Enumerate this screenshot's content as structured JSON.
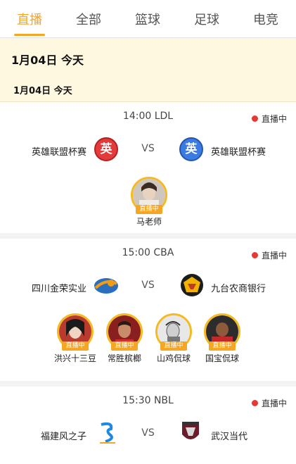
{
  "tabs": [
    {
      "label": "直播",
      "active": true
    },
    {
      "label": "全部",
      "active": false
    },
    {
      "label": "篮球",
      "active": false
    },
    {
      "label": "足球",
      "active": false
    },
    {
      "label": "电竞",
      "active": false
    }
  ],
  "accent_color": "#f5a623",
  "live_dot_color": "#e53935",
  "date_banner": {
    "main": "1月04日 今天",
    "sub": "1月04日 今天"
  },
  "matches": [
    {
      "time_league": "14:00 LDL",
      "status": "直播中",
      "home": {
        "name": "英雄联盟杯赛",
        "logo_text": "英"
      },
      "vs": "VS",
      "away": {
        "name": "英雄联盟杯赛",
        "logo_text": "英"
      },
      "anchors": [
        {
          "name": "马老师",
          "badge": "直播中"
        }
      ]
    },
    {
      "time_league": "15:00 CBA",
      "status": "直播中",
      "home": {
        "name": "四川金荣实业"
      },
      "vs": "VS",
      "away": {
        "name": "九台农商银行"
      },
      "anchors": [
        {
          "name": "洪兴十三豆",
          "badge": "直播中"
        },
        {
          "name": "常胜槟榔",
          "badge": "直播中"
        },
        {
          "name": "山鸡侃球",
          "badge": "直播中"
        },
        {
          "name": "国宝侃球",
          "badge": "直播中"
        }
      ]
    },
    {
      "time_league": "15:30 NBL",
      "status": "直播中",
      "home": {
        "name": "福建风之子"
      },
      "vs": "VS",
      "away": {
        "name": "武汉当代"
      }
    }
  ]
}
